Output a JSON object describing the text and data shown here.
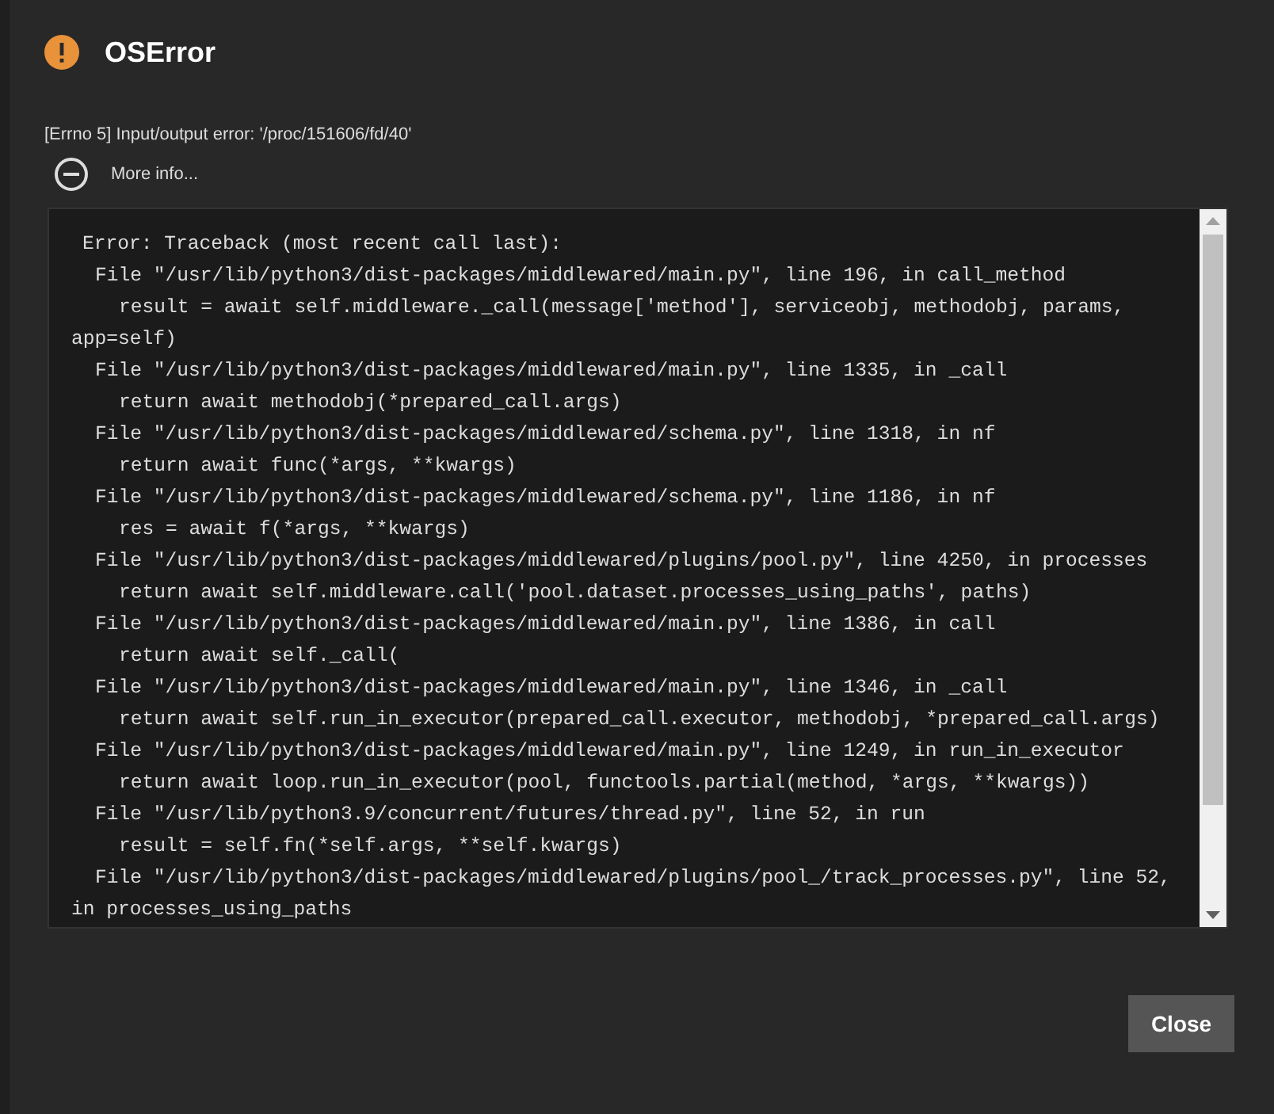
{
  "dialog": {
    "title": "OSError",
    "message": "[Errno 5] Input/output error: '/proc/151606/fd/40'",
    "more_info": {
      "label": "More info...",
      "expanded": true
    },
    "traceback": [
      {
        "kind": "head",
        "text": "Error: Traceback (most recent call last):"
      },
      {
        "kind": "file",
        "text": "File \"/usr/lib/python3/dist-packages/middlewared/main.py\", line 196, in call_method"
      },
      {
        "kind": "code",
        "text": "result = await self.middleware._call(message['method'], serviceobj, methodobj, params,"
      },
      {
        "kind": "wrap",
        "text": "app=self)"
      },
      {
        "kind": "file",
        "text": "File \"/usr/lib/python3/dist-packages/middlewared/main.py\", line 1335, in _call"
      },
      {
        "kind": "code",
        "text": "return await methodobj(*prepared_call.args)"
      },
      {
        "kind": "file",
        "text": "File \"/usr/lib/python3/dist-packages/middlewared/schema.py\", line 1318, in nf"
      },
      {
        "kind": "code",
        "text": "return await func(*args, **kwargs)"
      },
      {
        "kind": "file",
        "text": "File \"/usr/lib/python3/dist-packages/middlewared/schema.py\", line 1186, in nf"
      },
      {
        "kind": "code",
        "text": "res = await f(*args, **kwargs)"
      },
      {
        "kind": "file",
        "text": "File \"/usr/lib/python3/dist-packages/middlewared/plugins/pool.py\", line 4250, in processes"
      },
      {
        "kind": "code",
        "text": "return await self.middleware.call('pool.dataset.processes_using_paths', paths)"
      },
      {
        "kind": "file",
        "text": "File \"/usr/lib/python3/dist-packages/middlewared/main.py\", line 1386, in call"
      },
      {
        "kind": "code",
        "text": "return await self._call("
      },
      {
        "kind": "file",
        "text": "File \"/usr/lib/python3/dist-packages/middlewared/main.py\", line 1346, in _call"
      },
      {
        "kind": "code",
        "text": "return await self.run_in_executor(prepared_call.executor, methodobj, *prepared_call.args)"
      },
      {
        "kind": "file",
        "text": "File \"/usr/lib/python3/dist-packages/middlewared/main.py\", line 1249, in run_in_executor"
      },
      {
        "kind": "code",
        "text": "return await loop.run_in_executor(pool, functools.partial(method, *args, **kwargs))"
      },
      {
        "kind": "file",
        "text": "File \"/usr/lib/python3.9/concurrent/futures/thread.py\", line 52, in run"
      },
      {
        "kind": "code",
        "text": "result = self.fn(*self.args, **self.kwargs)"
      },
      {
        "kind": "file",
        "text": "File \"/usr/lib/python3/dist-packages/middlewared/plugins/pool_/track_processes.py\", line 52,"
      },
      {
        "kind": "wrap",
        "text": "in processes_using_paths"
      }
    ],
    "buttons": [
      {
        "label": "Close"
      }
    ]
  }
}
